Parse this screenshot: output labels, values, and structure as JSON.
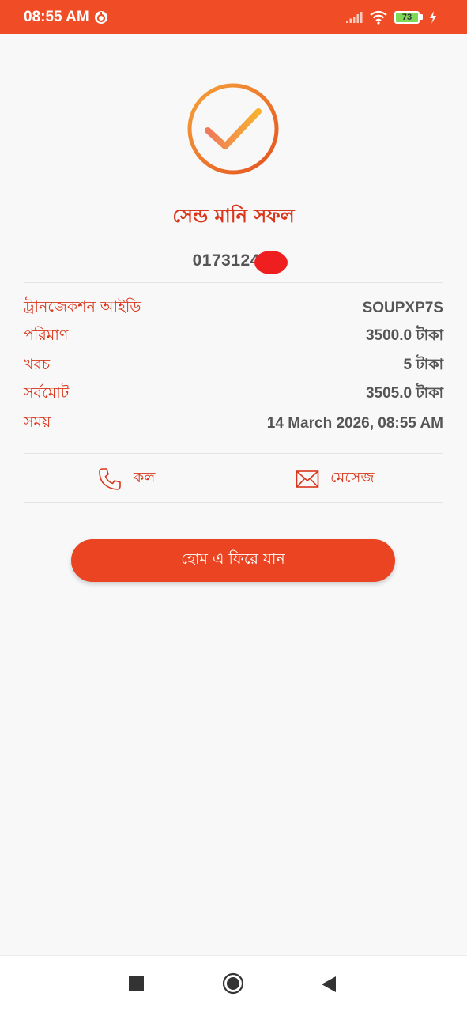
{
  "status_bar": {
    "time": "08:55 AM",
    "battery_level": "73",
    "icons": [
      "app-notification-icon",
      "signal-icon",
      "wifi-icon",
      "battery-icon",
      "charging-icon"
    ],
    "background_color": "#f04d26"
  },
  "success": {
    "icon": "check-circle-icon",
    "title": "সেন্ড মানি সফল",
    "recipient_number": "0173124 0"
  },
  "details": [
    {
      "label": "ট্রানজেকশন আইডি",
      "value": "SOUPXP7S"
    },
    {
      "label": "পরিমাণ",
      "value": "3500.0 টাকা"
    },
    {
      "label": "খরচ",
      "value": "5 টাকা"
    },
    {
      "label": "সর্বমোট",
      "value": "3505.0 টাকা"
    },
    {
      "label": "সময়",
      "value": "14 March 2026, 08:55 AM"
    }
  ],
  "actions": {
    "call_label": "কল",
    "call_icon": "phone-icon",
    "message_label": "মেসেজ",
    "message_icon": "envelope-icon"
  },
  "home_button_label": "হোম এ ফিরে যান",
  "nav_bar": {
    "icons": [
      "recents-square-icon",
      "home-circle-icon",
      "back-triangle-icon"
    ]
  },
  "colors": {
    "accent": "#d9361b",
    "button": "#ea4422"
  }
}
